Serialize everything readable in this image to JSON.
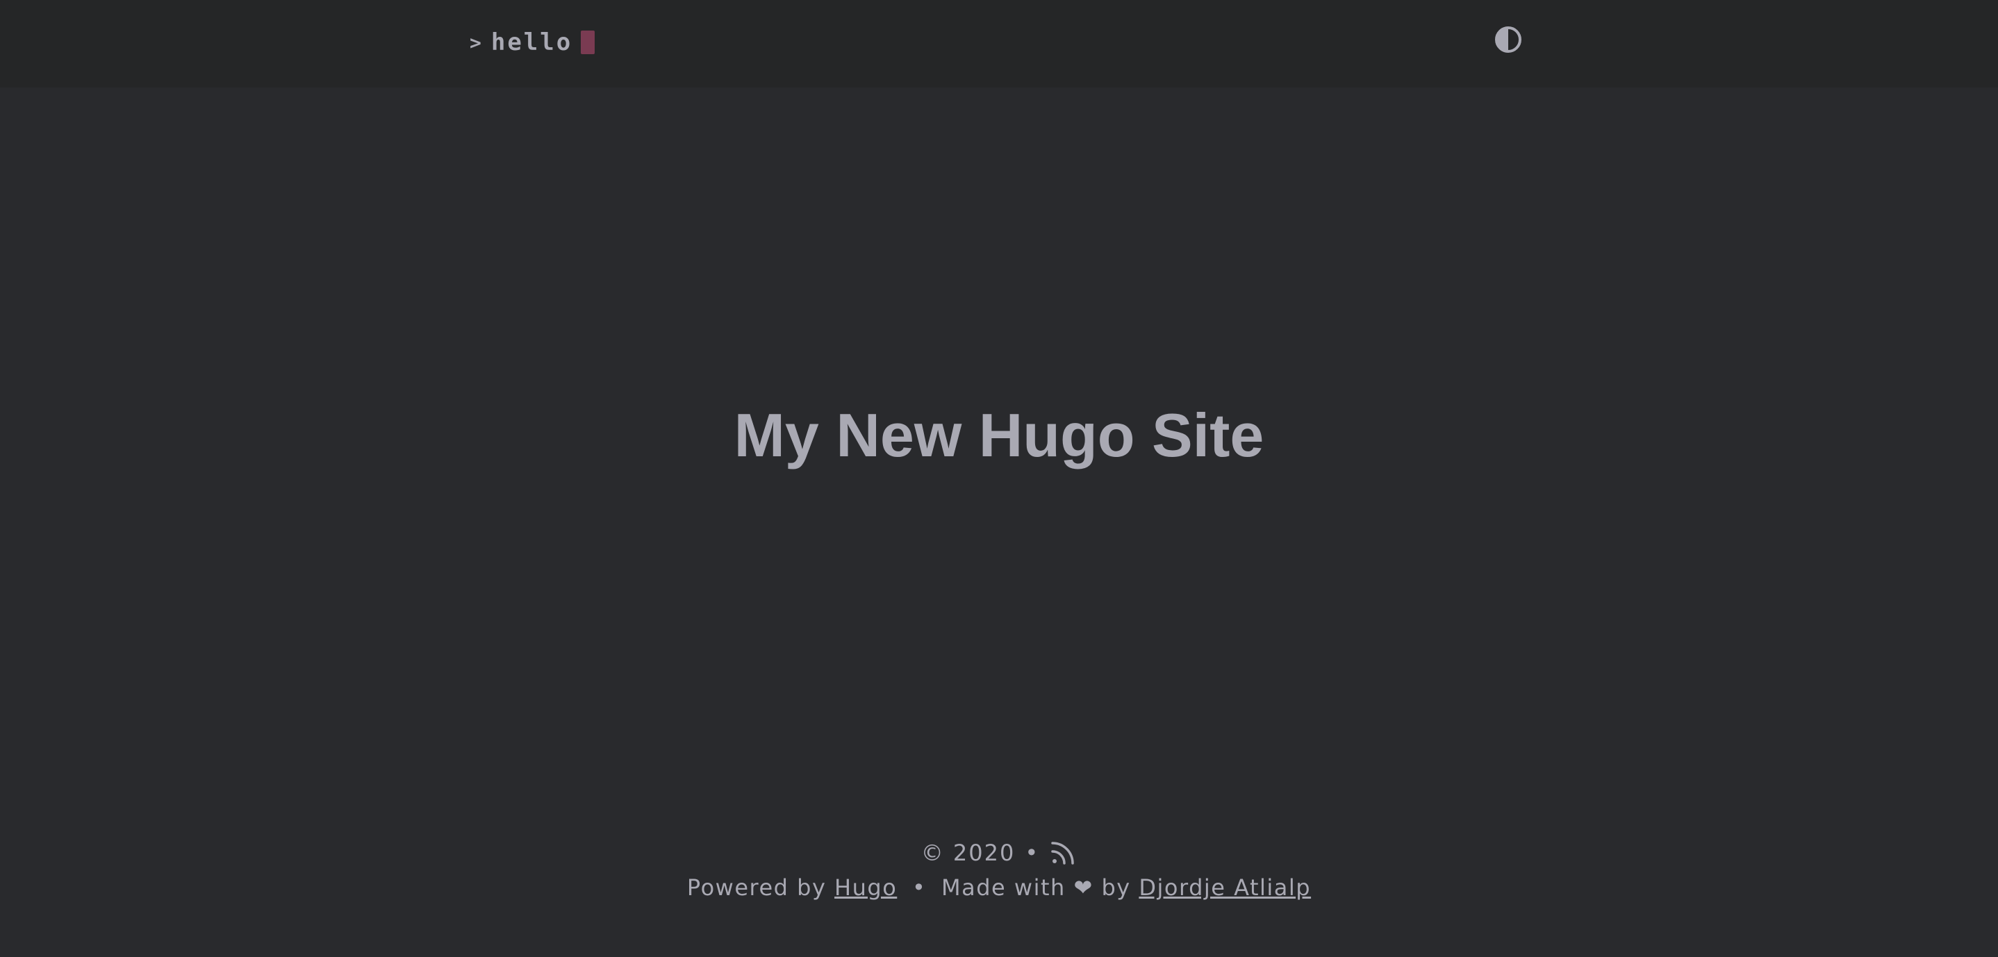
{
  "header": {
    "logo_prompt": ">",
    "logo_text": "hello",
    "cursor_color": "#7a3b52",
    "theme_toggle_icon": "contrast-icon"
  },
  "main": {
    "title": "My New Hugo Site"
  },
  "footer": {
    "copyright": "© 2020",
    "bullet": "•",
    "rss_icon": "rss-icon",
    "powered_by_prefix": "Powered by",
    "powered_by_link": "Hugo",
    "made_with_prefix": "Made with",
    "heart": "❤",
    "by": "by",
    "author_link": "Djordje Atlialp"
  },
  "colors": {
    "background": "#292a2d",
    "header_background": "#252627",
    "text": "#a9a9b3"
  }
}
